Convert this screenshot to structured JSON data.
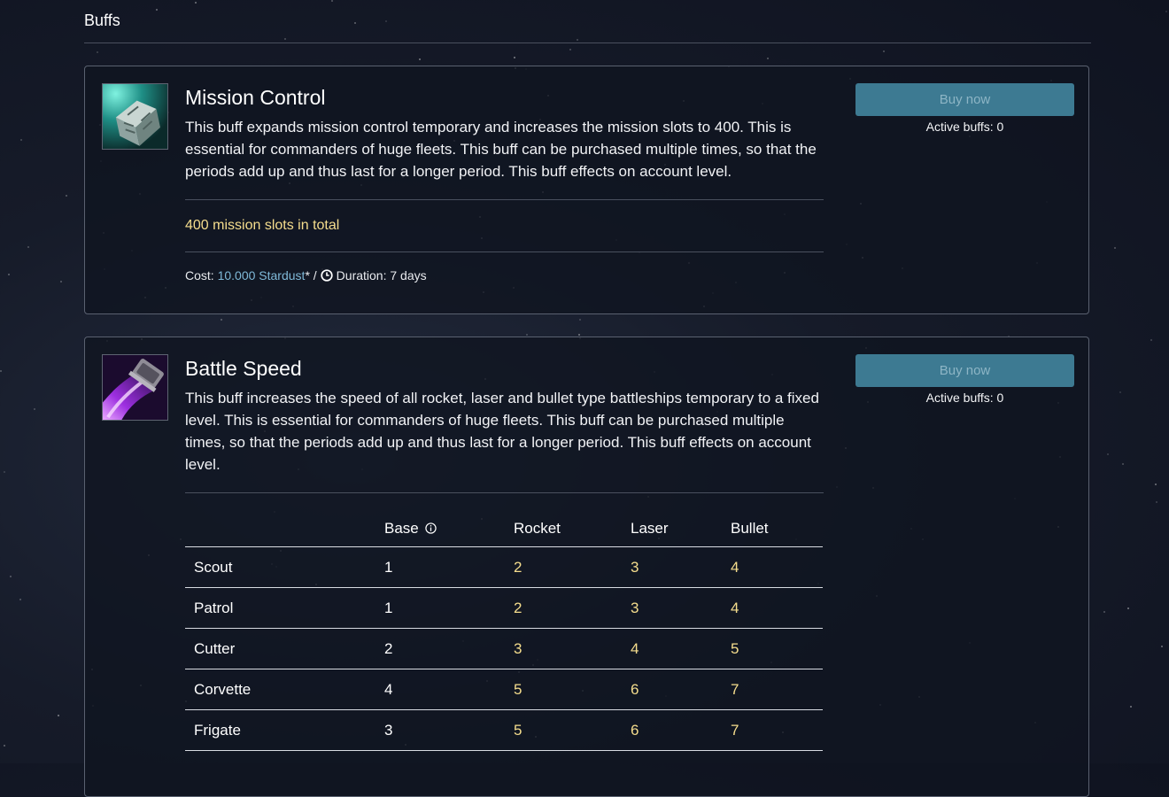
{
  "page": {
    "title": "Buffs"
  },
  "buffs": [
    {
      "title": "Mission Control",
      "icon": "mission-control-cube-icon",
      "description": "This buff expands mission control temporary and increases the mission slots to 400. This is essential for commanders of huge fleets. This buff can be purchased multiple times, so that the periods add up and thus last for a longer period. This buff effects on account level.",
      "highlight": "400 mission slots in total",
      "cost_label": "Cost:",
      "cost_value": "10.000 Stardust",
      "cost_suffix": "* /",
      "duration": "Duration: 7 days",
      "buy_label": "Buy now",
      "active_buffs": "Active buffs: 0"
    },
    {
      "title": "Battle Speed",
      "icon": "battle-speed-thruster-icon",
      "description": "This buff increases the speed of all rocket, laser and bullet type battleships temporary to a fixed level. This is essential for commanders of huge fleets. This buff can be purchased multiple times, so that the periods add up and thus last for a longer period. This buff effects on account level.",
      "buy_label": "Buy now",
      "active_buffs": "Active buffs: 0",
      "table": {
        "headers": [
          "",
          "Base",
          "Rocket",
          "Laser",
          "Bullet"
        ],
        "rows": [
          [
            "Scout",
            "1",
            "2",
            "3",
            "4"
          ],
          [
            "Patrol",
            "1",
            "2",
            "3",
            "4"
          ],
          [
            "Cutter",
            "2",
            "3",
            "4",
            "5"
          ],
          [
            "Corvette",
            "4",
            "5",
            "6",
            "7"
          ],
          [
            "Frigate",
            "3",
            "5",
            "6",
            "7"
          ]
        ]
      }
    }
  ],
  "colors": {
    "accent_gold": "#f5dd8d",
    "link": "#7fb9d8",
    "button": "#3d7a92"
  }
}
